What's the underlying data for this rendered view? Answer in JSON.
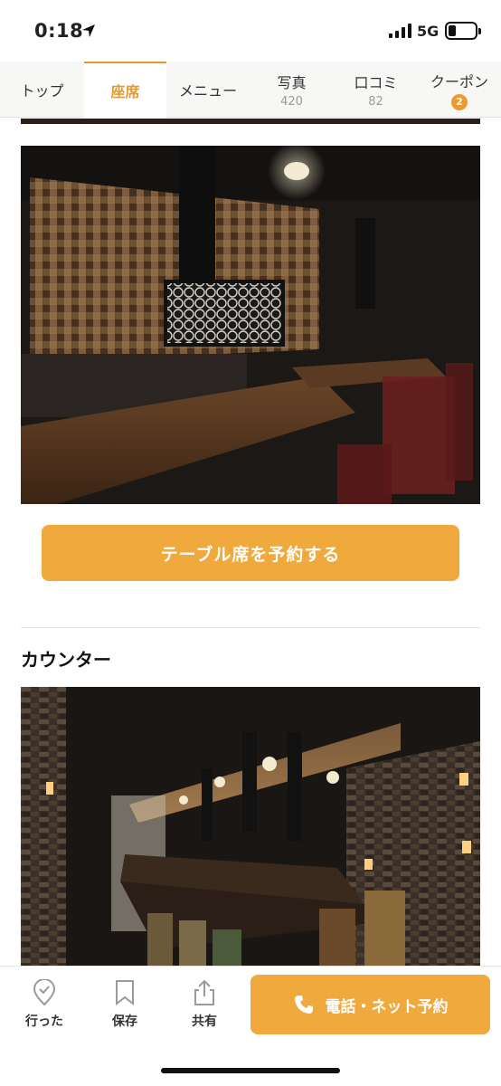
{
  "status_bar": {
    "time": "0:18",
    "network": "5G",
    "signal_bars": 4,
    "battery_level": 0.25
  },
  "tabs": [
    {
      "label": "トップ",
      "count": ""
    },
    {
      "label": "座席",
      "count": "",
      "active": true
    },
    {
      "label": "メニュー",
      "count": ""
    },
    {
      "label": "写真",
      "count": "420"
    },
    {
      "label": "口コミ",
      "count": "82"
    },
    {
      "label": "クーポン",
      "badge": "2"
    }
  ],
  "main": {
    "table_section": {
      "photo_icon": "table-seating-photo",
      "reserve_label": "テーブル席を予約する"
    },
    "counter_section": {
      "title": "カウンター",
      "photo_icon": "counter-seating-photo"
    }
  },
  "bottom_bar": {
    "went_label": "行った",
    "save_label": "保存",
    "share_label": "共有",
    "call_label": "電話・ネット予約"
  },
  "colors": {
    "accent": "#f0a93d",
    "active_tab": "#e79a2c"
  }
}
